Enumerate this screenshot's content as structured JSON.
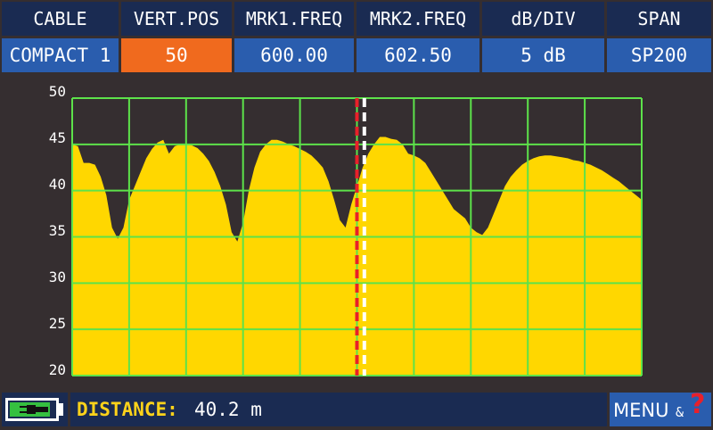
{
  "header": {
    "cells": [
      {
        "label": "CABLE",
        "value": "COMPACT 1"
      },
      {
        "label": "VERT.POS",
        "value": "50"
      },
      {
        "label": "MRK1.FREQ",
        "value": "600.00"
      },
      {
        "label": "MRK2.FREQ",
        "value": "602.50"
      },
      {
        "label": "dB/DIV",
        "value": "5 dB"
      },
      {
        "label": "SPAN",
        "value": "SP200"
      }
    ]
  },
  "colors": {
    "background": "#352e30",
    "header_bg": "#1a2b52",
    "value_bg": "#2a5dae",
    "active_value_bg": "#f06a1e",
    "trace_fill": "#ffd700",
    "grid": "#5de24a",
    "marker1": "#e8202a",
    "marker2": "#ffffff"
  },
  "chart_data": {
    "type": "area",
    "ylim": [
      20,
      50
    ],
    "y_ticks": [
      "50",
      "45",
      "40",
      "35",
      "30",
      "25",
      "20"
    ],
    "grid": true,
    "x": [
      0,
      1,
      2,
      3,
      4,
      5,
      6,
      7,
      8,
      9,
      10,
      11,
      12,
      13,
      14,
      15,
      16,
      17,
      18,
      19,
      20,
      21,
      22,
      23,
      24,
      25,
      26,
      27,
      28,
      29,
      30,
      31,
      32,
      33,
      34,
      35,
      36,
      37,
      38,
      39,
      40,
      41,
      42,
      43,
      44,
      45,
      46,
      47,
      48,
      49,
      50,
      51,
      52,
      53,
      54,
      55,
      56,
      57,
      58,
      59,
      60,
      61,
      62,
      63,
      64,
      65,
      66,
      67,
      68,
      69,
      70,
      71,
      72,
      73,
      74,
      75,
      76,
      77,
      78,
      79,
      80,
      81,
      82,
      83,
      84,
      85,
      86,
      87,
      88,
      89,
      90,
      91,
      92,
      93,
      94,
      95,
      96,
      97,
      98,
      99,
      100
    ],
    "series": [
      {
        "values": [
          45.0,
          44.8,
          43.0,
          43.0,
          42.8,
          41.5,
          39.5,
          36.0,
          34.8,
          36.0,
          39.0,
          40.5,
          42.0,
          43.5,
          44.5,
          45.2,
          45.5,
          44.0,
          44.8,
          45.0,
          45.0,
          44.9,
          44.6,
          44.0,
          43.2,
          42.0,
          40.5,
          38.5,
          35.5,
          34.5,
          36.5,
          40.0,
          42.5,
          44.2,
          45.0,
          45.5,
          45.5,
          45.3,
          45.0,
          44.8,
          44.5,
          44.2,
          43.8,
          43.2,
          42.5,
          41.0,
          39.0,
          36.8,
          36.0,
          38.5,
          40.5,
          42.5,
          44.0,
          45.0,
          45.8,
          45.8,
          45.6,
          45.5,
          45.0,
          44.0,
          43.8,
          43.5,
          43.0,
          42.0,
          41.0,
          40.0,
          39.0,
          38.0,
          37.5,
          37.0,
          36.0,
          35.5,
          35.2,
          36.0,
          37.5,
          39.0,
          40.5,
          41.5,
          42.2,
          42.8,
          43.2,
          43.5,
          43.7,
          43.8,
          43.8,
          43.7,
          43.6,
          43.5,
          43.3,
          43.2,
          43.0,
          42.8,
          42.5,
          42.2,
          41.8,
          41.4,
          41.0,
          40.5,
          40.0,
          39.5,
          39.0
        ]
      }
    ],
    "markers": [
      {
        "name": "MRK1",
        "x": 50,
        "color": "#e8202a",
        "style": "dashed"
      },
      {
        "name": "MRK2",
        "x": 51.3,
        "color": "#ffffff",
        "style": "dashed"
      }
    ]
  },
  "status": {
    "battery_level": 0.9,
    "distance_label": "DISTANCE:",
    "distance_value": "40.2 m",
    "menu_label": "MENU",
    "amp_label": "&",
    "help_label": "?"
  }
}
